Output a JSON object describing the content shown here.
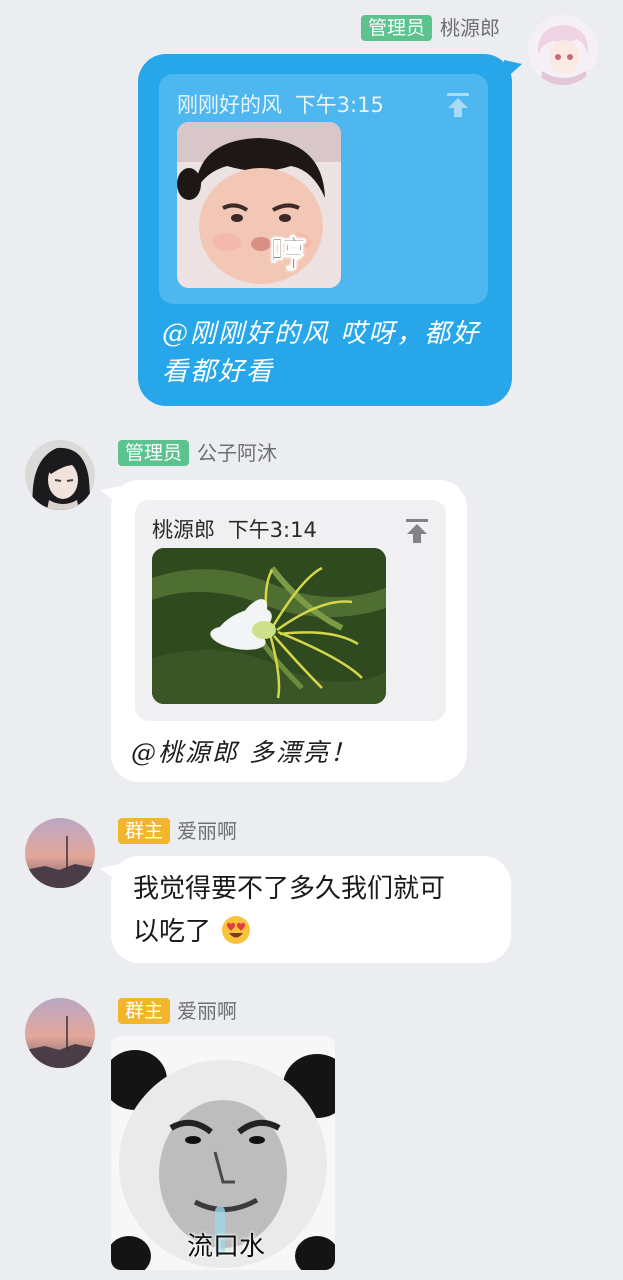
{
  "messages": [
    {
      "role": "管理员",
      "sender": "桃源郎",
      "quote": {
        "author": "刚刚好的风",
        "time": "下午3:15",
        "sticker_caption": "哼"
      },
      "text": [
        "@刚刚好的风 哎呀，都好",
        "看都好看"
      ]
    },
    {
      "role": "管理员",
      "sender": "公子阿沐",
      "quote": {
        "author": "桃源郎",
        "time": "下午3:14"
      },
      "text": "@桃源郎 多漂亮！"
    },
    {
      "role": "群主",
      "sender": "爱丽啊",
      "text": [
        "我觉得要不了多久我们就可",
        "以吃了"
      ]
    },
    {
      "role": "群主",
      "sender": "爱丽啊",
      "sticker_caption": "流口水"
    }
  ],
  "colors": {
    "admin_badge": "#5cc38f",
    "owner_badge": "#f2b62a",
    "outgoing_bubble": "#27a7e9",
    "incoming_bubble": "#ffffff",
    "background": "#ecedf1"
  },
  "icons": {
    "pin": "pin-to-top-icon",
    "emoji": "heart-eyes-emoji"
  }
}
